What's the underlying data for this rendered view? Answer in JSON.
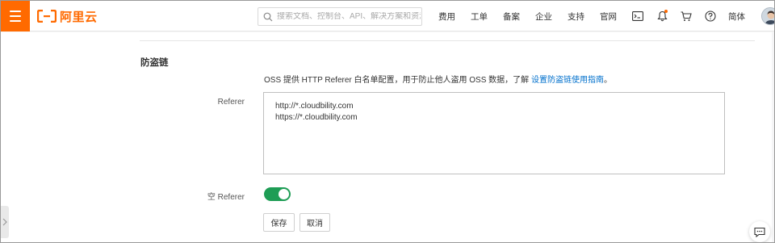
{
  "header": {
    "brand": "阿里云",
    "search_placeholder": "搜索文档、控制台、API、解决方案和资源",
    "nav": [
      {
        "label": "费用"
      },
      {
        "label": "工单"
      },
      {
        "label": "备案"
      },
      {
        "label": "企业"
      },
      {
        "label": "支持"
      },
      {
        "label": "官网"
      }
    ],
    "icons": [
      "terminal-icon",
      "bell-icon",
      "cart-icon",
      "help-icon"
    ],
    "language": "简体",
    "accent": "#ff6a00"
  },
  "hotlink": {
    "title": "防盗链",
    "description": "OSS 提供 HTTP Referer 白名单配置，用于防止他人盗用 OSS 数据，了解",
    "description_link": "设置防盗链使用指南",
    "description_end": "。",
    "referer_label": "Referer",
    "referer_value": "http://*.cloudbility.com\nhttps://*.cloudbility.com",
    "empty_referer_label": "空 Referer",
    "empty_referer_enabled": true,
    "toggle_color": "#1e9d55",
    "save_label": "保存",
    "cancel_label": "取消"
  }
}
